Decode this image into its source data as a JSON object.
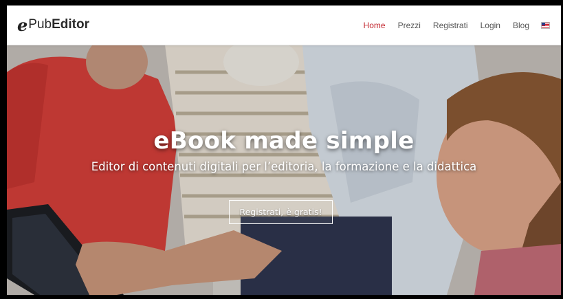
{
  "brand": {
    "logo_e": "e",
    "logo_pub": "Pub",
    "logo_editor": "Editor"
  },
  "nav": {
    "items": [
      {
        "label": "Home",
        "active": true
      },
      {
        "label": "Prezzi",
        "active": false
      },
      {
        "label": "Registrati",
        "active": false
      },
      {
        "label": "Login",
        "active": false
      },
      {
        "label": "Blog",
        "active": false
      }
    ],
    "language_icon": "us-flag-icon",
    "active_color": "#c3272f"
  },
  "hero": {
    "title": "eBook made simple",
    "subtitle": "Editor di contenuti digitali per l’editoria, la formazione e la didattica",
    "cta_label": "Registrati, è gratis!"
  }
}
